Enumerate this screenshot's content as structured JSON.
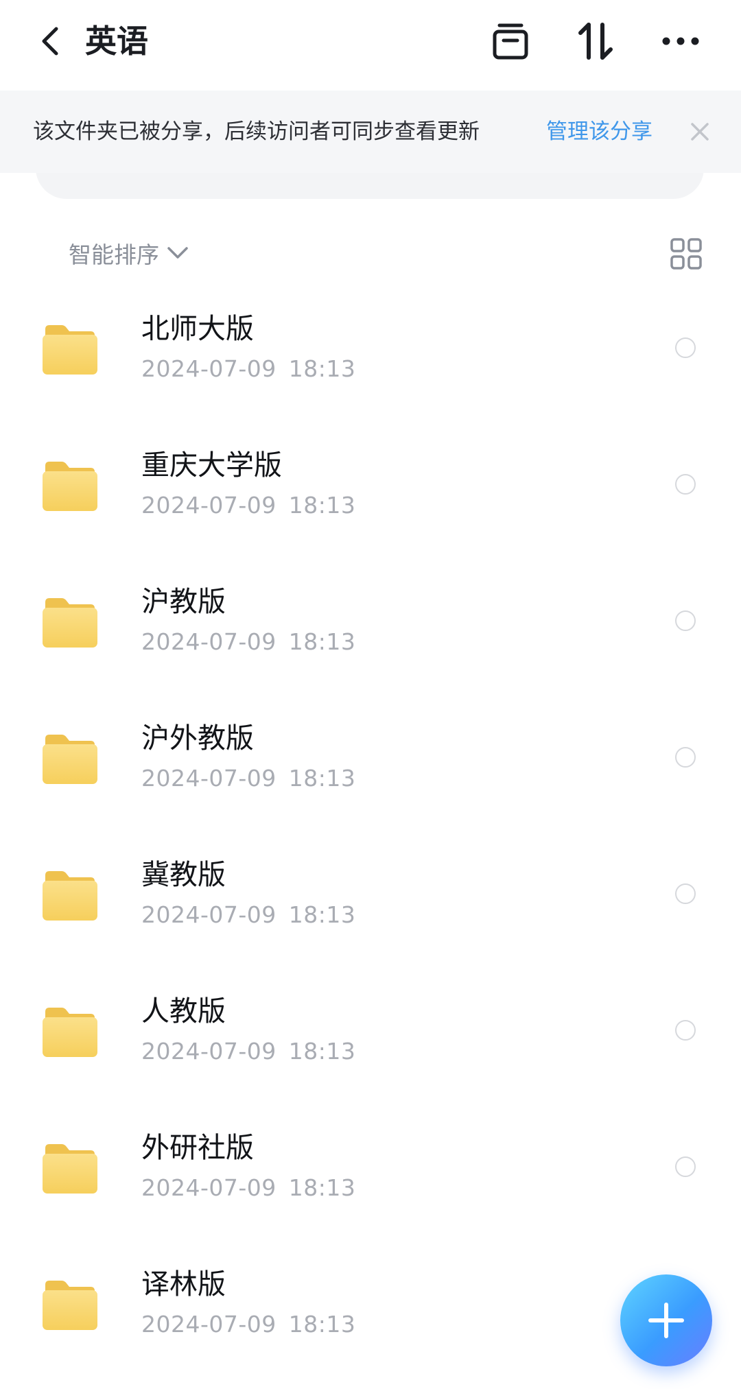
{
  "header": {
    "title": "英语",
    "icons": [
      "back-icon",
      "archive-icon",
      "sort-icon",
      "more-icon"
    ]
  },
  "banner": {
    "message": "该文件夹已被分享，后续访问者可同步查看更新",
    "link_label": "管理该分享"
  },
  "toolbar": {
    "sort_label": "智能排序"
  },
  "files": [
    {
      "name": "北师大版",
      "date": "2024-07-09",
      "time": "18:13"
    },
    {
      "name": "重庆大学版",
      "date": "2024-07-09",
      "time": "18:13"
    },
    {
      "name": "沪教版",
      "date": "2024-07-09",
      "time": "18:13"
    },
    {
      "name": "沪外教版",
      "date": "2024-07-09",
      "time": "18:13"
    },
    {
      "name": "冀教版",
      "date": "2024-07-09",
      "time": "18:13"
    },
    {
      "name": "人教版",
      "date": "2024-07-09",
      "time": "18:13"
    },
    {
      "name": "外研社版",
      "date": "2024-07-09",
      "time": "18:13"
    },
    {
      "name": "译林版",
      "date": "2024-07-09",
      "time": "18:13"
    }
  ],
  "colors": {
    "accent_link": "#3f97ea",
    "folder": "#f8d56a",
    "fab_gradient_start": "#5fd4ff",
    "fab_gradient_end": "#6a7dff"
  }
}
